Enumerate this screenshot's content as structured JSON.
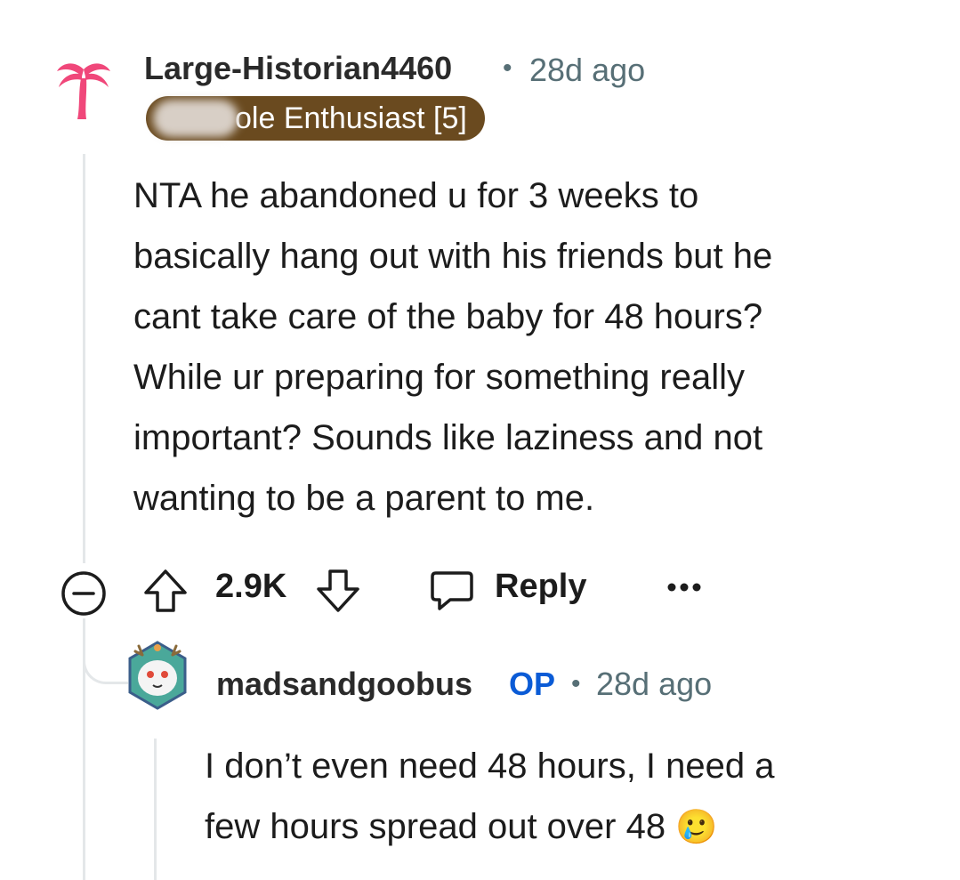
{
  "comment": {
    "username": "Large-Historian4460",
    "time": "28d ago",
    "flair": "ole Enthusiast [5]",
    "avatar_icon": "palm-tree-icon",
    "body_lines": [
      "NTA he abandoned u for 3 weeks to",
      "basically hang out with his friends but he",
      "cant take care of the baby for 48 hours?",
      "While ur preparing for something really",
      "important? Sounds like laziness and not",
      "wanting to be a parent to me."
    ],
    "score": "2.9K",
    "reply_label": "Reply"
  },
  "reply": {
    "username": "madsandgoobus",
    "op_label": "OP",
    "time": "28d ago",
    "body_lines": [
      "I don’t even need 48 hours, I need a",
      "few hours spread out over 48"
    ],
    "emoji": "🥲"
  },
  "colors": {
    "flair_bg": "#6a4a1f",
    "op": "#0a5bd6",
    "meta": "#576f76",
    "avatar_pink": "#f0477a"
  }
}
